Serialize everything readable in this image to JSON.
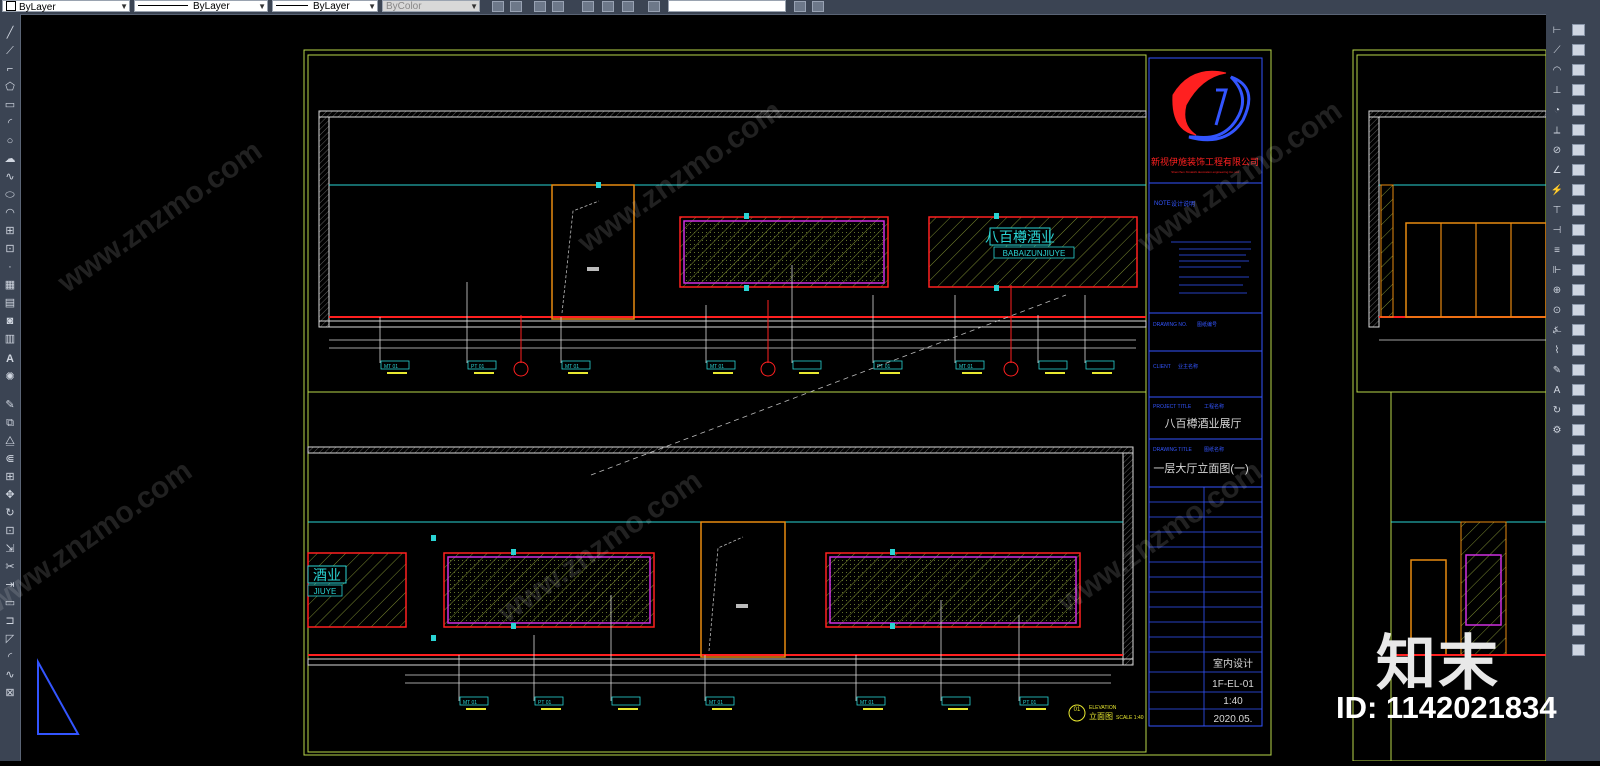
{
  "toolbar": {
    "color_dropdown": "ByLayer",
    "linetype_dropdown": "ByLayer",
    "lineweight_dropdown": "ByLayer",
    "plotstyle_dropdown": "ByColor"
  },
  "drawing": {
    "company_name": "新视伊施装饰工程有限公司",
    "company_sub": "Shenzhen Ximaishi decoration engineering Co.,Ltd",
    "notes_title": "设计说明",
    "notes_label": "NOTE",
    "drawing_no_label": "DRAWING NO.",
    "drawing_no_cn": "图纸编号",
    "client_label": "CLIENT",
    "client_cn": "业主名称",
    "project_label": "PROJECT TITLE",
    "project_cn": "工程名称",
    "project_title": "八百樽酒业展厅",
    "drawing_title_label": "DRAWING TITLE",
    "drawing_title_cn": "图纸名称",
    "drawing_title": "一层大厅立面图(一)",
    "discipline": "室内设计",
    "sheet_no": "1F-EL-01",
    "scale": "1:40",
    "date": "2020.05.",
    "sign_text": "八百樽酒业",
    "sign_sub": "BABAIZUNJIUYE",
    "sign_text_partial": "酒业",
    "sign_sub_partial": "JIUYE",
    "elevation_tag": "立面图",
    "elevation_label": "ELEVATION",
    "elevation_no": "01",
    "elevation_scale": "SCALE 1:40",
    "tag_mt": "MT 01",
    "tag_pt": "PT 01"
  },
  "watermark": {
    "text": "www.znzmo.com",
    "logo": "知末",
    "id_text": "ID: 1142021834"
  },
  "colors": {
    "ui_bg": "#3b4453",
    "frame": "#b7d64a",
    "wall": "#d8d8d8",
    "cyan": "#2ad4d4",
    "red": "#ff2020",
    "magenta": "#d030e0",
    "orange": "#e88a10",
    "blue": "#3355ff"
  }
}
